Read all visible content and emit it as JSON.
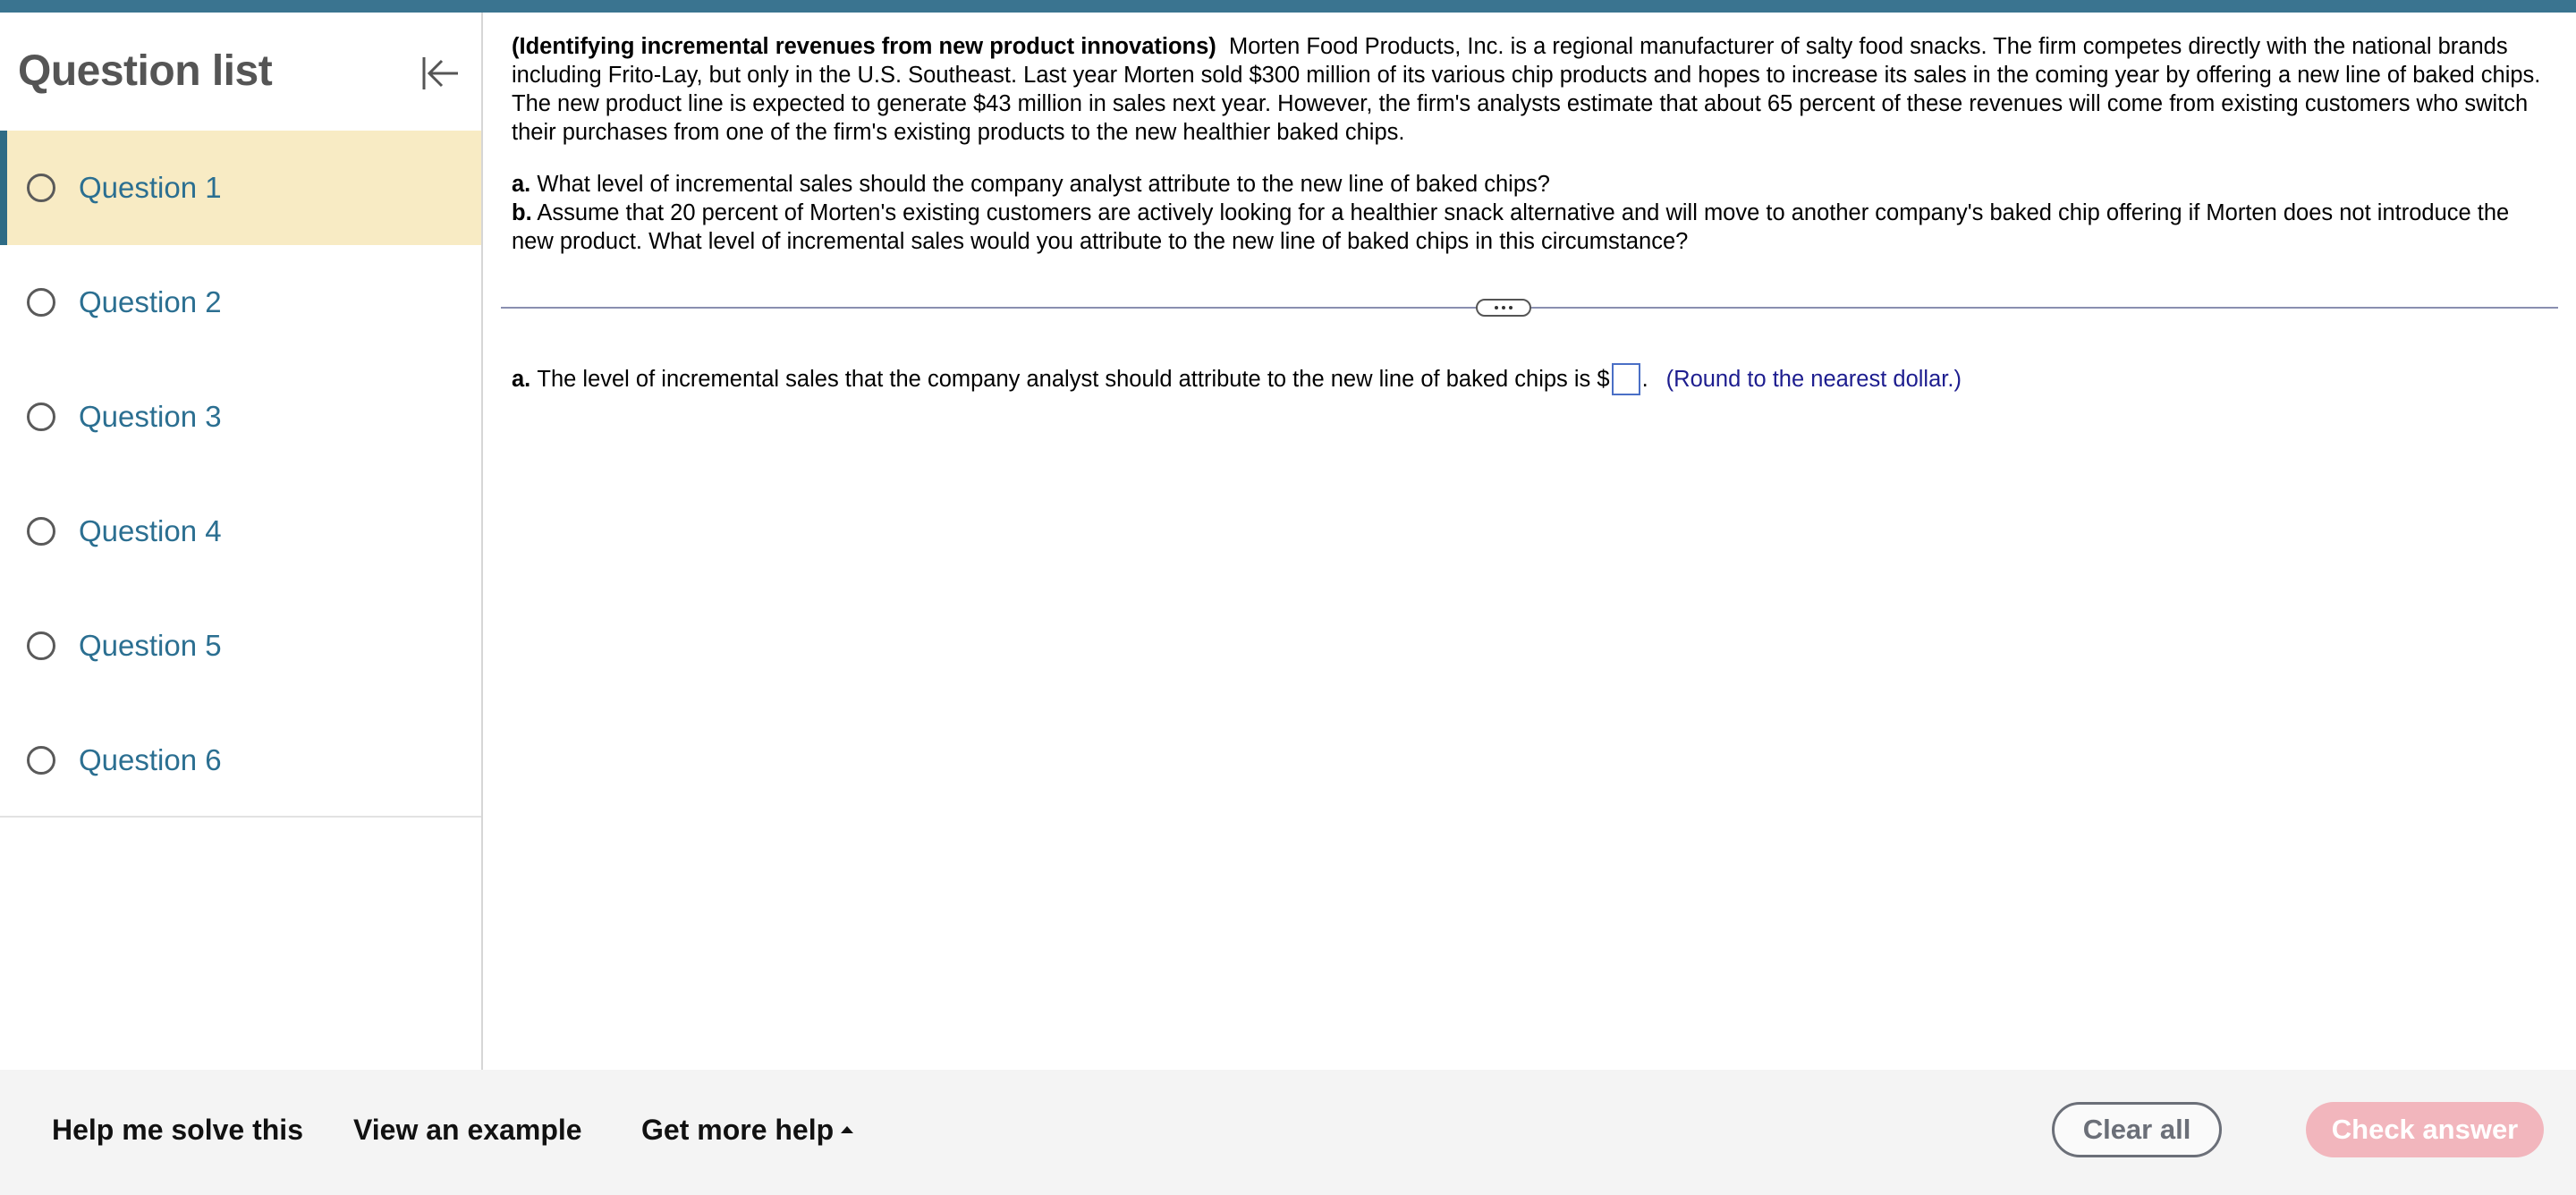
{
  "sidebar": {
    "title": "Question list",
    "questions": [
      {
        "label": "Question 1"
      },
      {
        "label": "Question 2"
      },
      {
        "label": "Question 3"
      },
      {
        "label": "Question 4"
      },
      {
        "label": "Question 5"
      },
      {
        "label": "Question 6"
      }
    ]
  },
  "problem": {
    "title": "(Identifying incremental revenues from new product innovations)",
    "body": "Morten Food Products, Inc. is a regional manufacturer of salty food snacks.  The firm competes directly with the national brands including Frito-Lay, but only in the U.S. Southeast.  Last year Morten sold $300 million of its various chip products and hopes to increase its sales in the coming year by offering a new line of baked chips.  The new product line is expected to generate $43 million in sales next year.  However, the firm's analysts estimate that about 65 percent of these revenues will come from existing customers who switch their purchases from one of the firm's existing products to the new healthier baked chips.",
    "part_a_label": "a.",
    "part_a_text": "What level of incremental sales should the company analyst attribute to the new line of baked chips?",
    "part_b_label": "b.",
    "part_b_text": "Assume that 20 percent of Morten's existing customers are actively looking for a healthier snack alternative and will move to another company's baked chip offering if Morten does not introduce the new product.  What level of incremental sales would you attribute to the new line of baked chips in this circumstance?"
  },
  "answer": {
    "label": "a.",
    "text": "The level of incremental sales that the company analyst should attribute to the new line of baked chips is $",
    "input_value": "",
    "suffix": ".",
    "note": "(Round to the nearest dollar.)"
  },
  "footer": {
    "help_solve": "Help me solve this",
    "view_example": "View an example",
    "more_help": "Get more help",
    "clear_all": "Clear all",
    "check_answer": "Check answer"
  },
  "colors": {
    "topbar": "#3a7490",
    "active_item": "#f8ebc4",
    "link": "#2b6f91",
    "check_answer_bg": "#f2b6bd"
  }
}
